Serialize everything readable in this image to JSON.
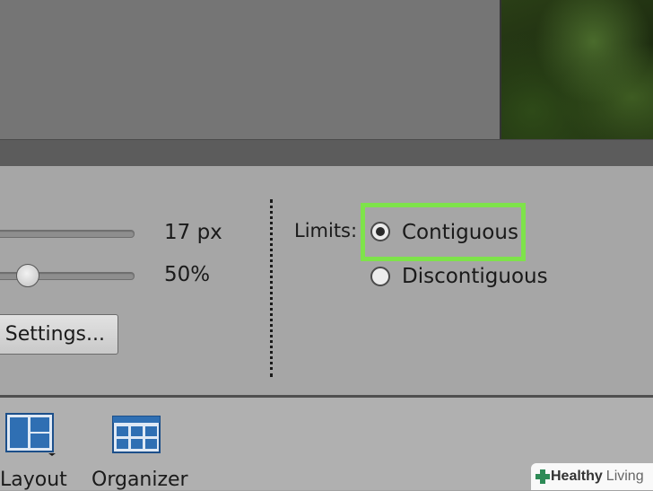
{
  "brush_options": {
    "size_value": "17 px",
    "tolerance_value": "50%",
    "settings_button_label": "Settings..."
  },
  "limits": {
    "label": "Limits:",
    "options": [
      {
        "label": "Contiguous",
        "selected": true
      },
      {
        "label": "Discontiguous",
        "selected": false
      }
    ]
  },
  "taskbar": {
    "items": [
      {
        "label": "Layout",
        "icon": "layout-icon"
      },
      {
        "label": "Organizer",
        "icon": "organizer-icon"
      }
    ]
  },
  "watermark": {
    "brand_bold": "Healthy",
    "brand_light": "Living"
  },
  "colors": {
    "highlight": "#7ee34a",
    "panel_bg": "#a6a6a6",
    "canvas_bg": "#757575",
    "icon_blue": "#2f6fb3"
  }
}
